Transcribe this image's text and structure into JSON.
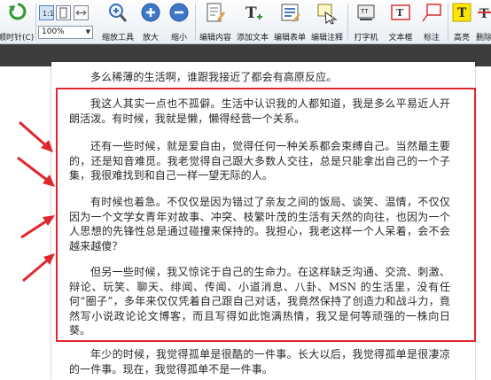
{
  "toolbar": {
    "rotate_label": "顺时针(C)",
    "zoom_value": "100%",
    "zoom_tool_label": "缩放工具",
    "zoom_in_label": "放大",
    "zoom_out_label": "缩小",
    "edit_content_label": "编辑内容",
    "add_text_label": "添加文本",
    "edit_form_label": "编辑表单",
    "edit_annotation_label": "编辑注释",
    "typewriter_label": "打字机",
    "textbox_label": "文本框",
    "callout_label": "标注",
    "highlight_label": "高亮",
    "strikeout_label": "删除"
  },
  "document": {
    "top_line": "多么稀薄的生活啊，谁跟我接近了都会有高原反应。",
    "paragraphs": [
      "我这人其实一点也不孤僻。生活中认识我的人都知道，我是多么平易近人开朗活泼。有时候，我就是懒，懒得经营一个关系。",
      "还有一些时候，就是爱自由，觉得任何一种关系都会束缚自己。当然最主要的，还是知音难觅。我老觉得自己跟大多数人交往，总是只能拿出自己的一个子集，我很难找到和自己一样一望无际的人。",
      "有时候也着急。不仅仅是因为错过了亲友之间的饭局、谈笑、温情，不仅仅因为一个文学女青年对故事、冲突、枝繁叶茂的生活有天然的向往，也因为一个人思想的先锋性总是通过碰撞来保持的。我担心，我老这样一个人呆着，会不会越来越傻？",
      "但另一些时候，我又惊诧于自己的生命力。在这样缺乏沟通、交流、刺激、辩论、玩笑、聊天、绯闻、传闻、小道消息、八卦、MSN 的生活里，没有任何“圈子”，多年来仅仅凭着自己跟自己对话，我竟然保持了创造力和战斗力，竟然写小说政论论文博客，而且写得如此饱满热情，我又是何等顽强的一株向日葵。",
      "年少的时候，我觉得孤单是很酷的一件事。长大以后，我觉得孤单是很凄凉的一件事。现在，我觉得孤单不是一件事。"
    ]
  },
  "colors": {
    "annotation_red": "#e0272d",
    "toolbar_bg": "#eef2f7",
    "dark_strip": "#3d3d3d"
  }
}
